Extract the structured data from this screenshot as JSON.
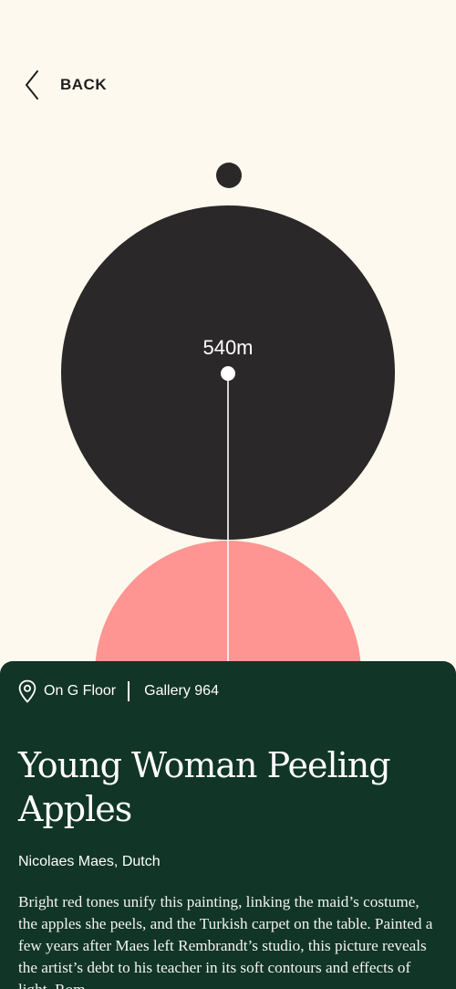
{
  "nav": {
    "back_label": "BACK",
    "back_icon": "chevron-left-icon"
  },
  "map": {
    "distance": "540m",
    "you_marker_color": "#2A2828",
    "current_zone_color": "#2A2828",
    "destination_zone_color": "#FE9592",
    "route_line_color": "#FFFFFF"
  },
  "artwork": {
    "location_icon": "map-pin-icon",
    "floor": "On G Floor",
    "gallery": "Gallery 964",
    "title": "Young Woman Peeling Apples",
    "artist": "Nicolaes Maes, Dutch",
    "description": "Bright red tones unify this painting, linking the maid’s costume, the apples she peels, and the Turkish carpet on the table. Painted a few years after Maes left Rembrandt’s studio, this picture reveals the artist’s debt to his teacher in its soft contours and effects of light. Rom"
  },
  "colors": {
    "background": "#FDF9EE",
    "card": "#113527",
    "text_dark": "#1F1F1F",
    "text_light": "#FFFFFF"
  }
}
